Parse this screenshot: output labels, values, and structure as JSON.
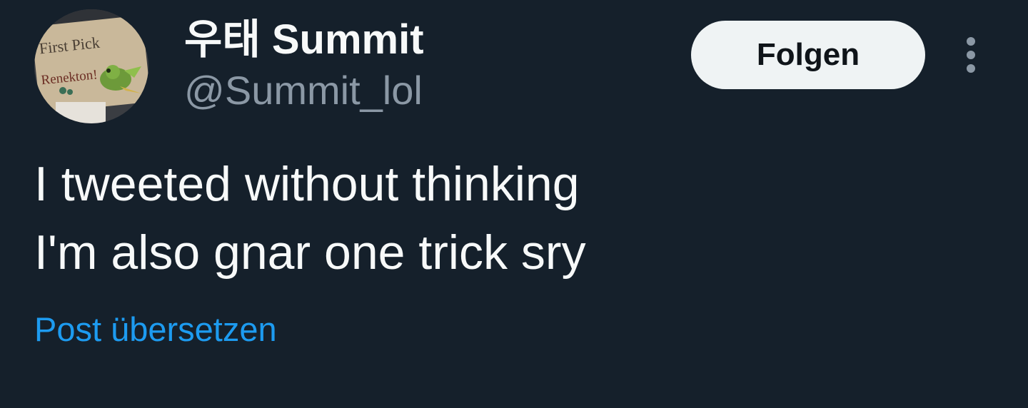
{
  "tweet": {
    "author": {
      "display_name": "우태 Summit",
      "handle": "@Summit_lol",
      "avatar_sign_text": [
        "First Pick",
        "Renekton!"
      ]
    },
    "follow_label": "Folgen",
    "more_icon": "more-vertical-icon",
    "text_lines": [
      "I tweeted without thinking",
      "I'm also gnar one trick sry"
    ],
    "translate_label": "Post übersetzen"
  },
  "colors": {
    "background": "#15202b",
    "primary_text": "#f7f9f9",
    "secondary_text": "#8b98a5",
    "link": "#1d9bf0",
    "button_bg": "#eff3f4",
    "button_text": "#0f1419"
  }
}
